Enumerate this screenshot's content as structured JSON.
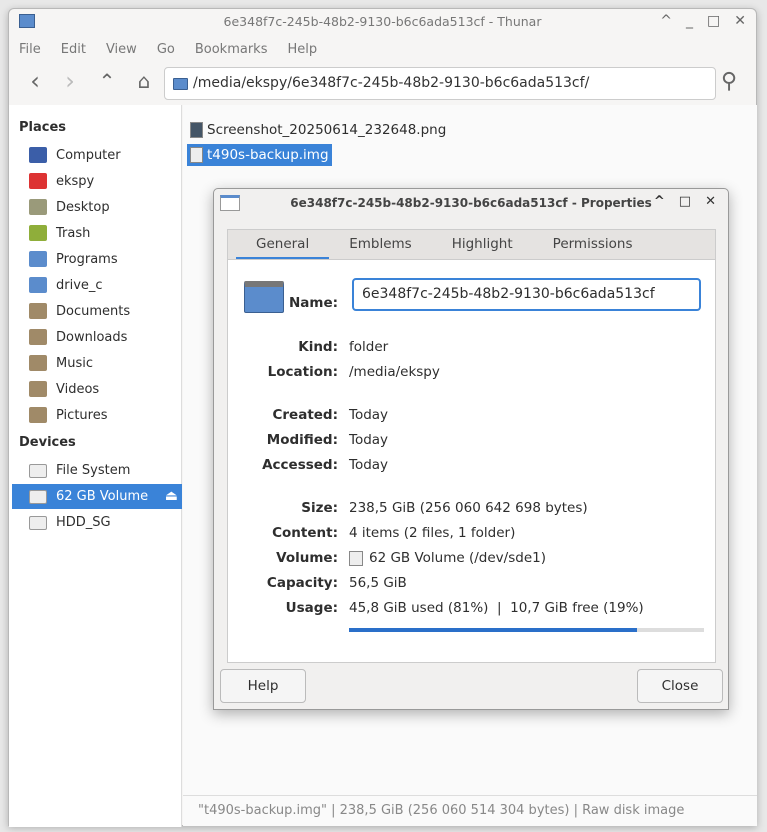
{
  "window": {
    "title": "6e348f7c-245b-48b2-9130-b6c6ada513cf - Thunar",
    "controls": [
      "^",
      "_",
      "□",
      "✕"
    ]
  },
  "menu": [
    "File",
    "Edit",
    "View",
    "Go",
    "Bookmarks",
    "Help"
  ],
  "toolbar": {
    "path": "/media/ekspy/6e348f7c-245b-48b2-9130-b6c6ada513cf/"
  },
  "sidebar": {
    "places_header": "Places",
    "places": [
      {
        "label": "Computer",
        "icon": "computer-icon",
        "color": "#3b5ea8"
      },
      {
        "label": "ekspy",
        "icon": "home-icon",
        "color": "#d33"
      },
      {
        "label": "Desktop",
        "icon": "desktop-icon",
        "color": "#9a9a7a"
      },
      {
        "label": "Trash",
        "icon": "trash-icon",
        "color": "#8fae3a"
      },
      {
        "label": "Programs",
        "icon": "folder-icon",
        "color": "#5b8ccc"
      },
      {
        "label": "drive_c",
        "icon": "folder-icon",
        "color": "#5b8ccc"
      },
      {
        "label": "Documents",
        "icon": "documents-folder-icon",
        "color": "#a08a68"
      },
      {
        "label": "Downloads",
        "icon": "downloads-folder-icon",
        "color": "#a08a68"
      },
      {
        "label": "Music",
        "icon": "music-folder-icon",
        "color": "#a08a68"
      },
      {
        "label": "Videos",
        "icon": "videos-folder-icon",
        "color": "#a08a68"
      },
      {
        "label": "Pictures",
        "icon": "pictures-folder-icon",
        "color": "#a08a68"
      }
    ],
    "devices_header": "Devices",
    "devices": [
      {
        "label": "File System",
        "selected": false
      },
      {
        "label": "62 GB Volume",
        "selected": true,
        "eject": "⏏"
      },
      {
        "label": "HDD_SG",
        "selected": false
      }
    ]
  },
  "files": [
    {
      "name": "Screenshot_20250614_232648.png",
      "selected": false
    },
    {
      "name": "t490s-backup.img",
      "selected": true
    }
  ],
  "status": "\"t490s-backup.img\"  |  238,5 GiB (256 060 514 304 bytes)  |  Raw disk image",
  "dialog": {
    "title": "6e348f7c-245b-48b2-9130-b6c6ada513cf - Properties",
    "tabs": [
      "General",
      "Emblems",
      "Highlight",
      "Permissions"
    ],
    "name_label": "Name:",
    "name_value": "6e348f7c-245b-48b2-9130-b6c6ada513cf",
    "rows": [
      {
        "label": "Kind:",
        "value": "folder"
      },
      {
        "label": "Location:",
        "value": "/media/ekspy"
      },
      {
        "label": "Created:",
        "value": "Today"
      },
      {
        "label": "Modified:",
        "value": "Today"
      },
      {
        "label": "Accessed:",
        "value": "Today"
      },
      {
        "label": "Size:",
        "value": "238,5 GiB (256 060 642 698 bytes)"
      },
      {
        "label": "Content:",
        "value": "4 items (2 files, 1 folder)"
      },
      {
        "label": "Volume:",
        "value": "62 GB Volume (/dev/sde1)"
      },
      {
        "label": "Capacity:",
        "value": "56,5 GiB"
      },
      {
        "label": "Usage:",
        "value": "45,8 GiB used (81%)  |  10,7 GiB free (19%)"
      }
    ],
    "usage_percent": 81,
    "help_label": "Help",
    "close_label": "Close"
  }
}
